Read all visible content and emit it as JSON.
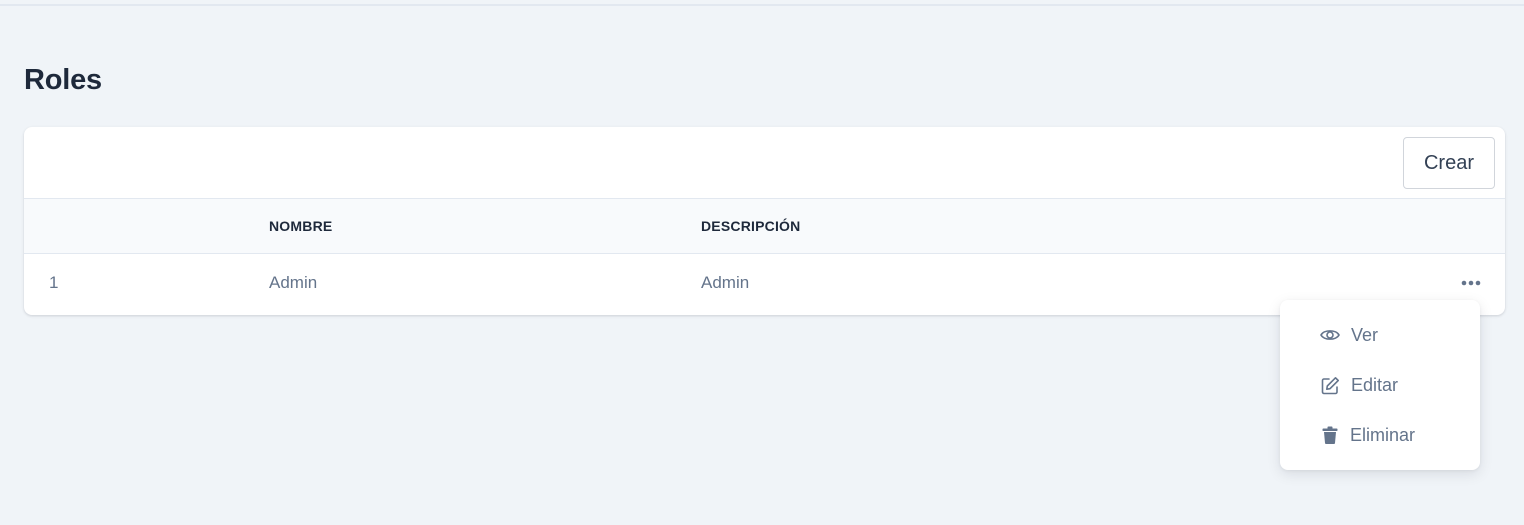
{
  "page": {
    "title": "Roles"
  },
  "toolbar": {
    "create_label": "Crear"
  },
  "table": {
    "columns": [
      "",
      "NOMBRE",
      "DESCRIPCIÓN"
    ],
    "rows": [
      {
        "id": "1",
        "name": "Admin",
        "description": "Admin"
      }
    ]
  },
  "row_menu": {
    "trigger_icon": "more-horizontal-icon",
    "items": [
      {
        "label": "Ver",
        "icon": "eye-icon"
      },
      {
        "label": "Editar",
        "icon": "edit-icon"
      },
      {
        "label": "Eliminar",
        "icon": "trash-icon"
      }
    ]
  },
  "colors": {
    "background": "#f0f4f8",
    "card": "#ffffff",
    "heading": "#1e293b",
    "muted_text": "#64748b",
    "border": "#e2e8f0"
  }
}
